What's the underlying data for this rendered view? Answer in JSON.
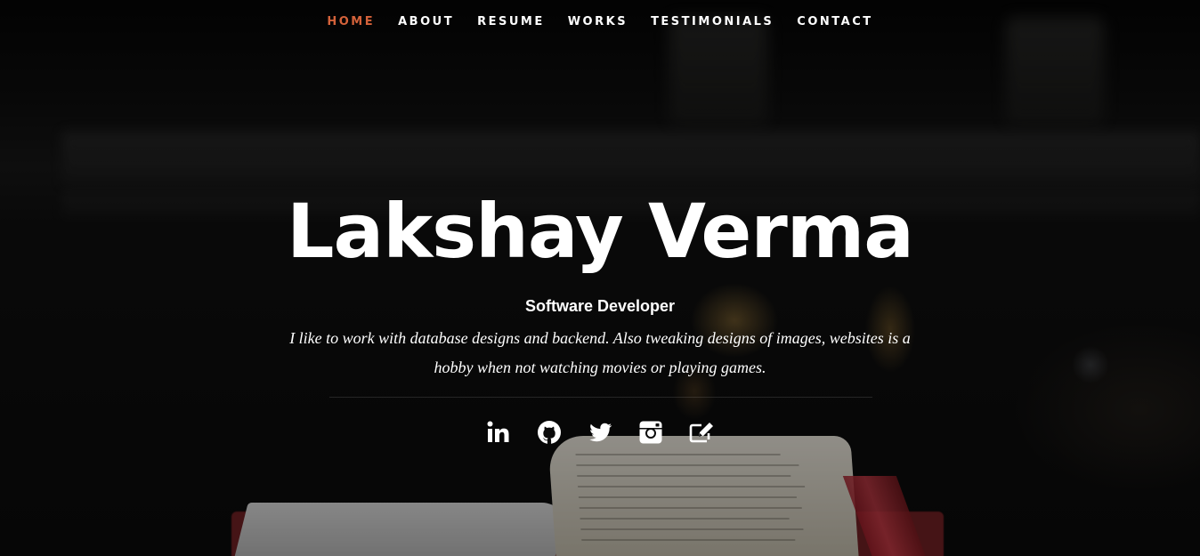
{
  "nav": {
    "items": [
      {
        "label": "HOME",
        "active": true
      },
      {
        "label": "ABOUT"
      },
      {
        "label": "RESUME"
      },
      {
        "label": "WORKS"
      },
      {
        "label": "TESTIMONIALS"
      },
      {
        "label": "CONTACT"
      }
    ],
    "active_color": "#d4623a"
  },
  "hero": {
    "name": "Lakshay Verma",
    "role": "Software Developer",
    "bio": "I like to work with database designs and backend. Also tweaking designs of images, websites is a hobby when not watching movies or playing games."
  },
  "social": {
    "icons": [
      "linkedin-icon",
      "github-icon",
      "twitter-icon",
      "instagram-icon",
      "blog-edit-icon"
    ]
  }
}
